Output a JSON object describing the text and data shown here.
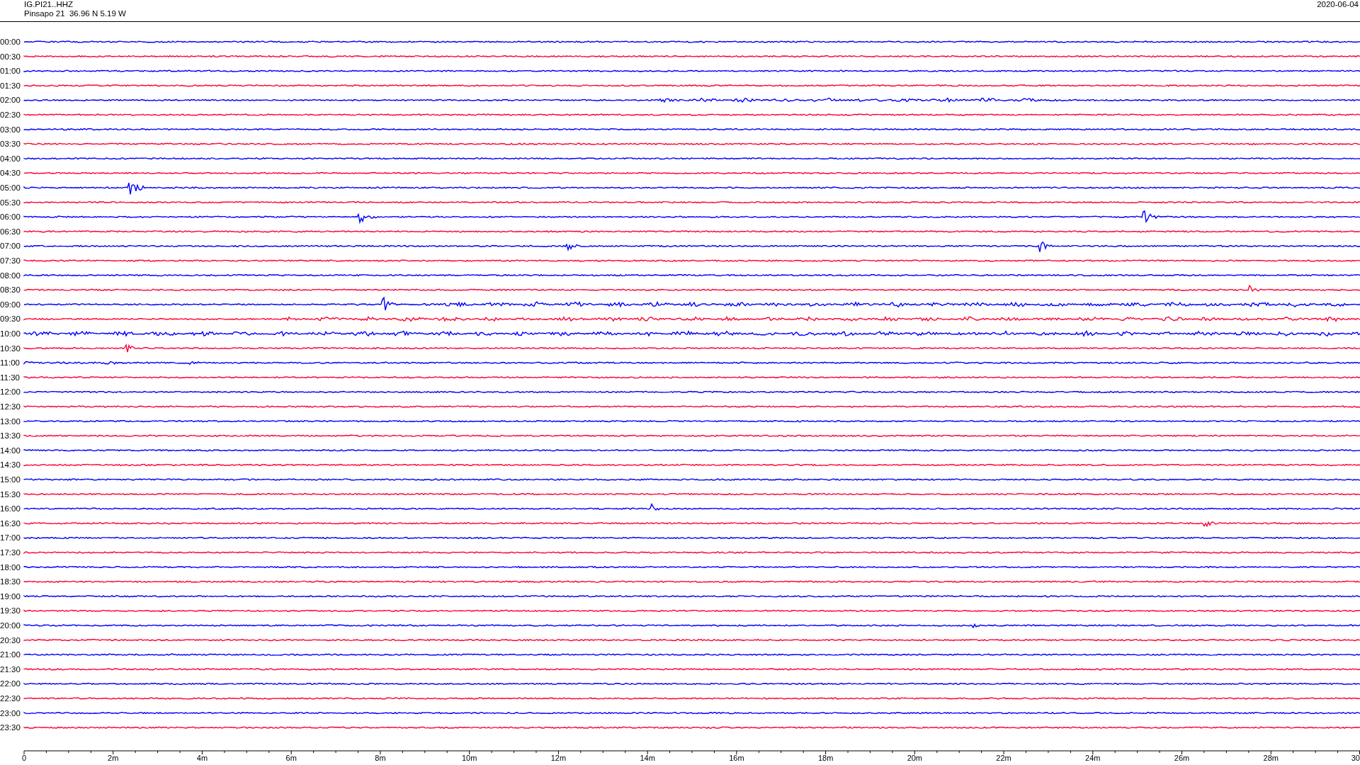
{
  "header": {
    "station_code": "IG.PI21..HHZ",
    "station_info": "Pinsapo 21  36.96 N 5.19 W",
    "date": "2020-06-04"
  },
  "rows": [
    {
      "label": "00:00",
      "color": "#0000ff"
    },
    {
      "label": "00:30",
      "color": "#ff0033"
    },
    {
      "label": "01:00",
      "color": "#0000ff"
    },
    {
      "label": "01:30",
      "color": "#ff0033"
    },
    {
      "label": "02:00",
      "color": "#0000ff"
    },
    {
      "label": "02:30",
      "color": "#ff0033"
    },
    {
      "label": "03:00",
      "color": "#0000ff"
    },
    {
      "label": "03:30",
      "color": "#ff0033"
    },
    {
      "label": "04:00",
      "color": "#0000ff"
    },
    {
      "label": "04:30",
      "color": "#ff0033"
    },
    {
      "label": "05:00",
      "color": "#0000ff"
    },
    {
      "label": "05:30",
      "color": "#ff0033"
    },
    {
      "label": "06:00",
      "color": "#0000ff"
    },
    {
      "label": "06:30",
      "color": "#ff0033"
    },
    {
      "label": "07:00",
      "color": "#0000ff"
    },
    {
      "label": "07:30",
      "color": "#ff0033"
    },
    {
      "label": "08:00",
      "color": "#0000ff"
    },
    {
      "label": "08:30",
      "color": "#ff0033"
    },
    {
      "label": "09:00",
      "color": "#0000ff"
    },
    {
      "label": "09:30",
      "color": "#ff0033"
    },
    {
      "label": "10:00",
      "color": "#0000ff"
    },
    {
      "label": "10:30",
      "color": "#ff0033"
    },
    {
      "label": "11:00",
      "color": "#0000ff"
    },
    {
      "label": "11:30",
      "color": "#ff0033"
    },
    {
      "label": "12:00",
      "color": "#0000ff"
    },
    {
      "label": "12:30",
      "color": "#ff0033"
    },
    {
      "label": "13:00",
      "color": "#0000ff"
    },
    {
      "label": "13:30",
      "color": "#ff0033"
    },
    {
      "label": "14:00",
      "color": "#0000ff"
    },
    {
      "label": "14:30",
      "color": "#ff0033"
    },
    {
      "label": "15:00",
      "color": "#0000ff"
    },
    {
      "label": "15:30",
      "color": "#ff0033"
    },
    {
      "label": "16:00",
      "color": "#0000ff"
    },
    {
      "label": "16:30",
      "color": "#ff0033"
    },
    {
      "label": "17:00",
      "color": "#0000ff"
    },
    {
      "label": "17:30",
      "color": "#ff0033"
    },
    {
      "label": "18:00",
      "color": "#0000ff"
    },
    {
      "label": "18:30",
      "color": "#ff0033"
    },
    {
      "label": "19:00",
      "color": "#0000ff"
    },
    {
      "label": "19:30",
      "color": "#ff0033"
    },
    {
      "label": "20:00",
      "color": "#0000ff"
    },
    {
      "label": "20:30",
      "color": "#ff0033"
    },
    {
      "label": "21:00",
      "color": "#0000ff"
    },
    {
      "label": "21:30",
      "color": "#ff0033"
    },
    {
      "label": "22:00",
      "color": "#0000ff"
    },
    {
      "label": "22:30",
      "color": "#ff0033"
    },
    {
      "label": "23:00",
      "color": "#0000ff"
    },
    {
      "label": "23:30",
      "color": "#ff0033"
    }
  ],
  "time_axis": {
    "ticks": [
      "0",
      "2m",
      "4m",
      "6m",
      "8m",
      "10m",
      "12m",
      "14m",
      "16m",
      "18m",
      "20m",
      "22m",
      "24m",
      "26m",
      "28m",
      "30"
    ]
  }
}
